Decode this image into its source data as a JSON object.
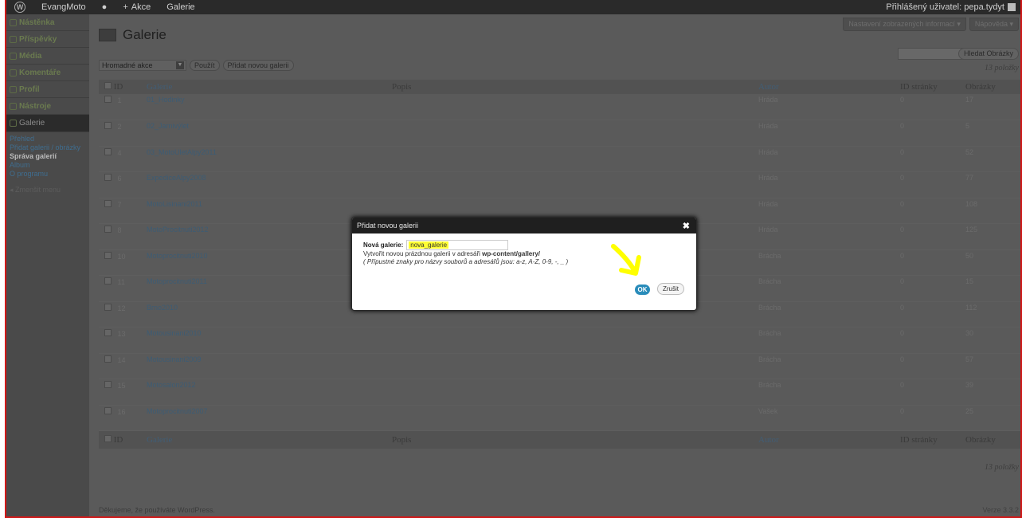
{
  "adminbar": {
    "site": "EvangMoto",
    "new_label": "Akce",
    "gallery": "Galerie",
    "user": "Přihlášený uživatel: pepa.tydyt"
  },
  "sidebar": {
    "items": [
      {
        "label": "Nástěnka",
        "icon": "dashboard-icon"
      },
      {
        "label": "Příspěvky",
        "icon": "pin-icon"
      },
      {
        "label": "Média",
        "icon": "media-icon"
      },
      {
        "label": "Komentáře",
        "icon": "comment-icon"
      },
      {
        "label": "Profil",
        "icon": "user-icon"
      },
      {
        "label": "Nástroje",
        "icon": "tools-icon"
      }
    ],
    "active": "Galerie",
    "submenu": [
      "Přehled",
      "Přidat galerii / obrázky",
      "Správa galerií",
      "Album",
      "O programu"
    ],
    "collapse": "Zmenšit menu"
  },
  "header": {
    "screen_options": "Nastavení zobrazených informací",
    "help": "Nápověda",
    "title": "Galerie"
  },
  "search": {
    "button": "Hledat Obrázky"
  },
  "bulk": {
    "select": "Hromadné akce",
    "apply": "Použít",
    "add": "Přidat novou galerii"
  },
  "count": "13 položky",
  "table": {
    "columns": [
      "ID",
      "Galerie",
      "Popis",
      "Autor",
      "ID stránky",
      "Obrázky"
    ],
    "rows": [
      {
        "id": "1",
        "name": "01_Hodinky",
        "desc": "",
        "author": "Hráda",
        "page": "0",
        "images": "17"
      },
      {
        "id": "2",
        "name": "02_Jarnivýlet",
        "desc": "",
        "author": "Hráda",
        "page": "0",
        "images": "5"
      },
      {
        "id": "4",
        "name": "03_MotoUletAlpy2011",
        "desc": "",
        "author": "Hráda",
        "page": "0",
        "images": "52"
      },
      {
        "id": "6",
        "name": "ExpediceAlpy2008",
        "desc": "",
        "author": "Hráda",
        "page": "0",
        "images": "77"
      },
      {
        "id": "7",
        "name": "MotoLisinani2011",
        "desc": "",
        "author": "Hráda",
        "page": "0",
        "images": "108"
      },
      {
        "id": "8",
        "name": "MotoProcitnuti2012",
        "desc": "",
        "author": "Hráda",
        "page": "0",
        "images": "125"
      },
      {
        "id": "10",
        "name": "Motoprocitnuti2010",
        "desc": "",
        "author": "Brácha",
        "page": "0",
        "images": "50"
      },
      {
        "id": "11",
        "name": "Motoprocitnuti2011",
        "desc": "",
        "author": "Brácha",
        "page": "0",
        "images": "15"
      },
      {
        "id": "12",
        "name": "Brno2010",
        "desc": "",
        "author": "Brácha",
        "page": "0",
        "images": "112"
      },
      {
        "id": "13",
        "name": "Motousinani2010",
        "desc": "",
        "author": "Brácha",
        "page": "0",
        "images": "30"
      },
      {
        "id": "14",
        "name": "Motousinani2009",
        "desc": "",
        "author": "Brácha",
        "page": "0",
        "images": "57"
      },
      {
        "id": "15",
        "name": "Motosalon2012",
        "desc": "",
        "author": "Brácha",
        "page": "0",
        "images": "39"
      },
      {
        "id": "16",
        "name": "Motoprocitnuti2007",
        "desc": "",
        "author": "Vašek",
        "page": "0",
        "images": "25"
      }
    ]
  },
  "footer": {
    "thanks": "Děkujeme, že používáte WordPress.",
    "version": "Verze 3.3.2"
  },
  "dialog": {
    "title": "Přidat novou galerii",
    "label": "Nová galerie:",
    "value": "nova_galerie",
    "hint_prefix": "Vytvořit novou prázdnou galerii v adresáři ",
    "hint_path": "wp-content/gallery/",
    "hint2": "( Přípustné znaky pro názvy souborů a adresářů jsou: a-z, A-Z, 0-9, -, _ )",
    "ok": "OK",
    "cancel": "Zrušit"
  },
  "colors": {
    "accent": "#298cba",
    "highlight": "#ffff33",
    "frame": "#d01818"
  }
}
